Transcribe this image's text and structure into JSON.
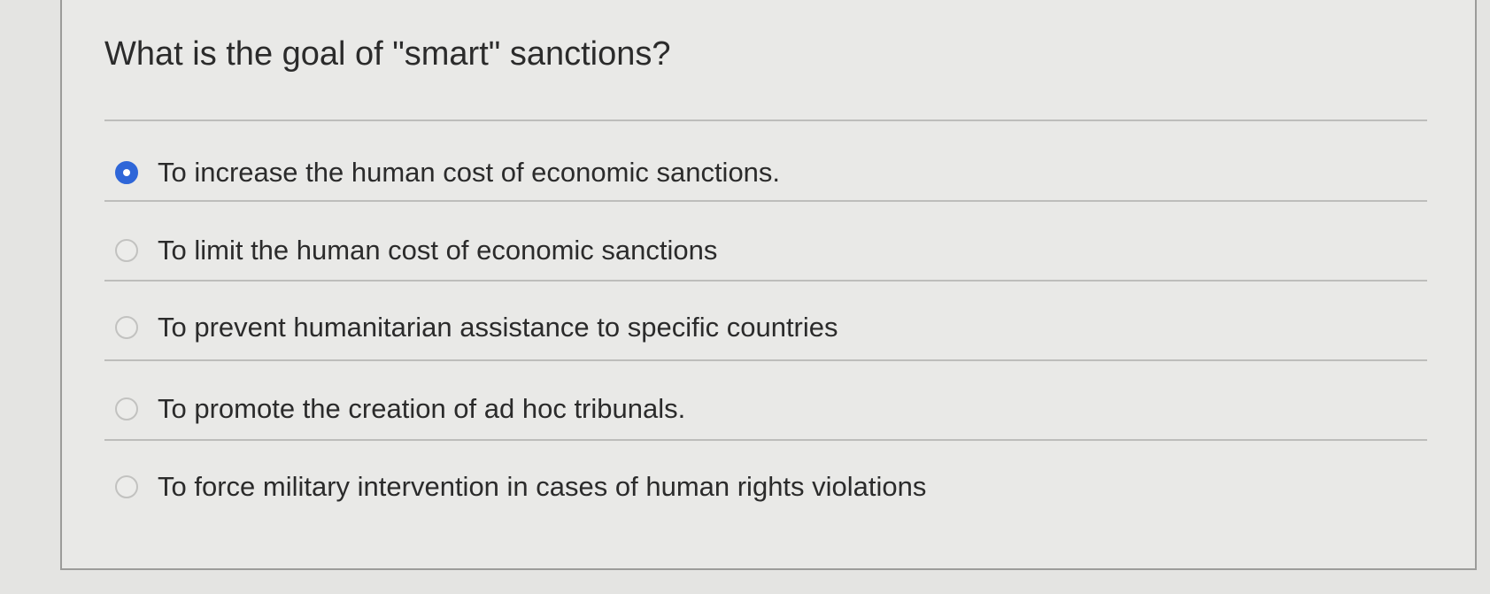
{
  "question": {
    "text": "What is the goal of \"smart\" sanctions?"
  },
  "options": [
    {
      "label": "To increase the human cost of economic sanctions.",
      "selected": true
    },
    {
      "label": "To limit the human cost of economic sanctions",
      "selected": false
    },
    {
      "label": "To prevent humanitarian assistance to specific countries",
      "selected": false
    },
    {
      "label": "To promote the creation of ad hoc tribunals.",
      "selected": false
    },
    {
      "label": "To force military intervention in cases of human rights violations",
      "selected": false
    }
  ],
  "colors": {
    "selected_radio": "#2e66d8",
    "text": "#2b2b2b",
    "background": "#e9e9e7"
  }
}
